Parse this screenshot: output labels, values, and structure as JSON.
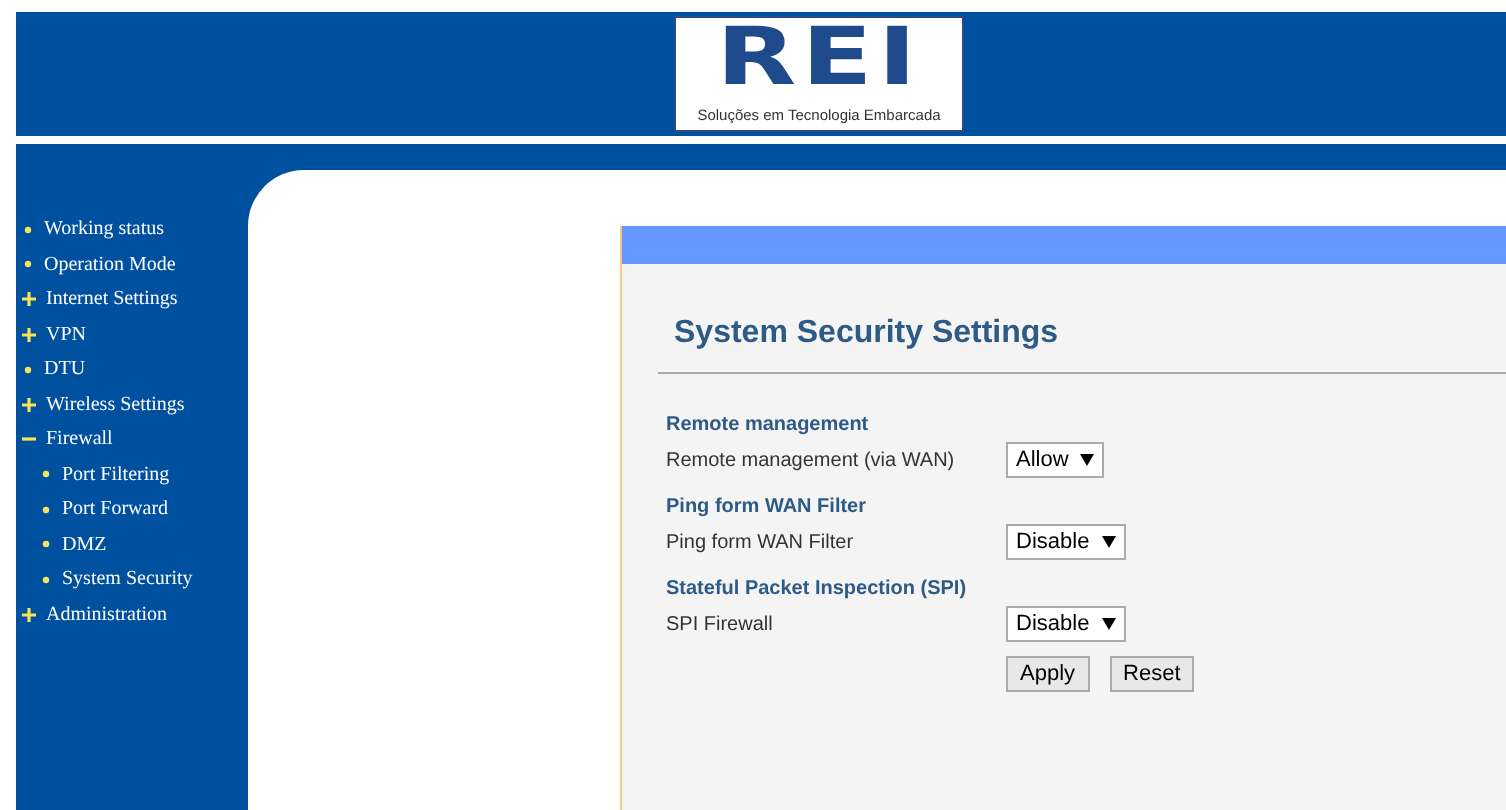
{
  "logo": {
    "mark": "REI",
    "tagline": "Soluções em Tecnologia Embarcada"
  },
  "sidebar": {
    "items": [
      {
        "label": "Working status",
        "kind": "leaf"
      },
      {
        "label": "Operation Mode",
        "kind": "leaf"
      },
      {
        "label": "Internet Settings",
        "kind": "folder",
        "expanded": false
      },
      {
        "label": "VPN",
        "kind": "folder",
        "expanded": false
      },
      {
        "label": "DTU",
        "kind": "leaf"
      },
      {
        "label": "Wireless Settings",
        "kind": "folder",
        "expanded": false
      },
      {
        "label": "Firewall",
        "kind": "folder",
        "expanded": true,
        "children": [
          {
            "label": "Port Filtering",
            "kind": "leaf"
          },
          {
            "label": "Port Forward",
            "kind": "leaf"
          },
          {
            "label": "DMZ",
            "kind": "leaf"
          },
          {
            "label": "System Security",
            "kind": "leaf"
          }
        ]
      },
      {
        "label": "Administration",
        "kind": "folder",
        "expanded": false
      }
    ]
  },
  "page": {
    "title": "System Security Settings",
    "sections": [
      {
        "heading": "Remote management",
        "label": "Remote management (via WAN)",
        "value": "Allow"
      },
      {
        "heading": "Ping form WAN Filter",
        "label": "Ping form WAN Filter",
        "value": "Disable"
      },
      {
        "heading": "Stateful Packet Inspection (SPI)",
        "label": "SPI Firewall",
        "value": "Disable"
      }
    ],
    "buttons": [
      "Apply",
      "Reset"
    ]
  }
}
